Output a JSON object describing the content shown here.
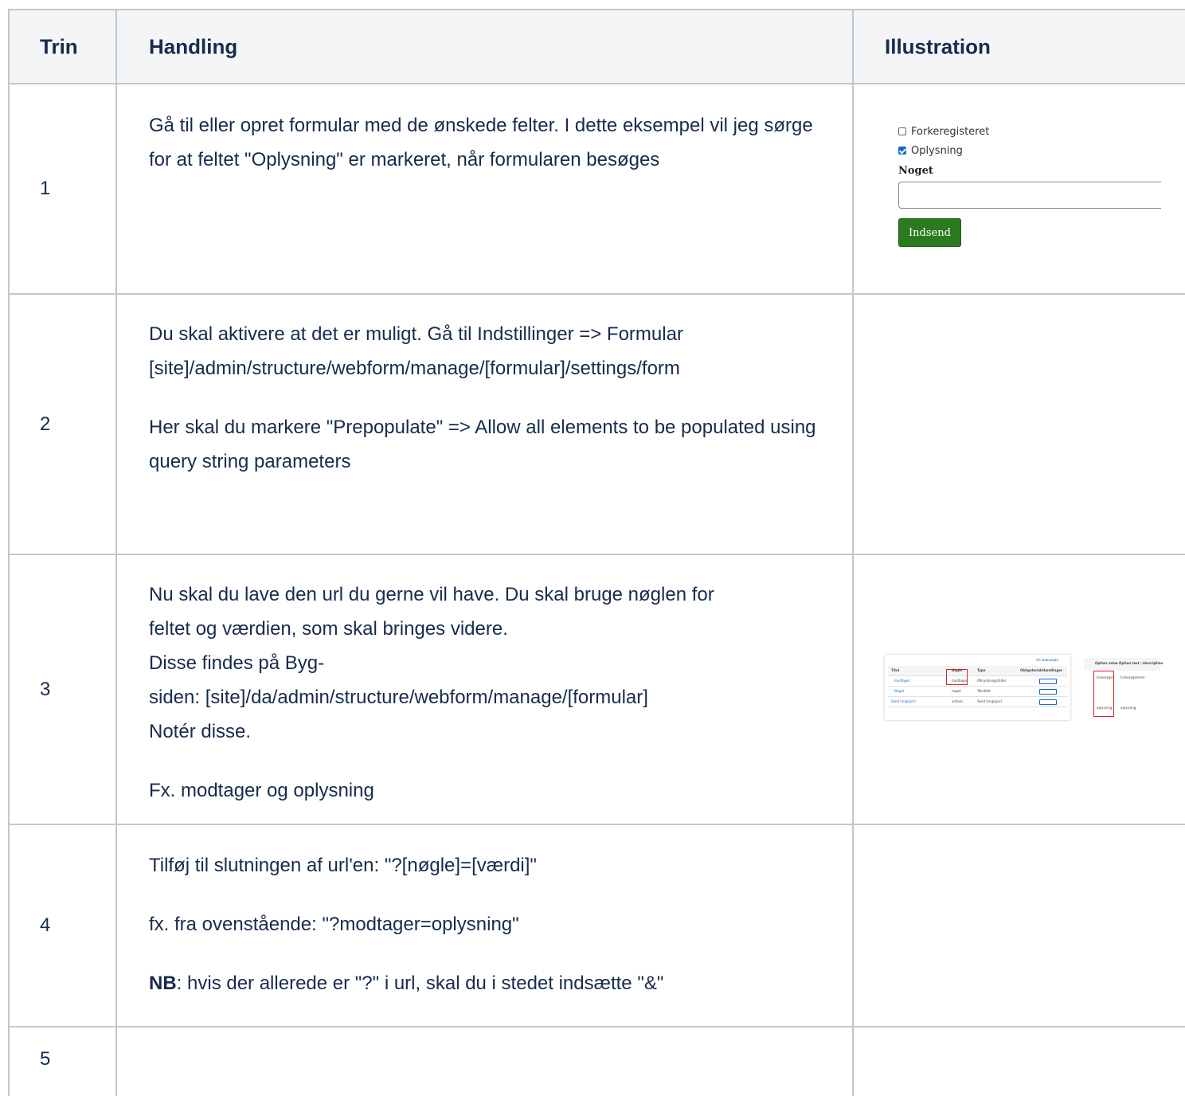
{
  "headers": {
    "step": "Trin",
    "action": "Handling",
    "illustration": "Illustration"
  },
  "rows": [
    {
      "step": "1",
      "paragraphs": [
        "Gå til eller opret formular med de ønskede felter. I dette eksempel vil jeg sørge for at feltet \"Oplysning\" er markeret, når formularen besøges"
      ]
    },
    {
      "step": "2",
      "paragraphs": [
        "Du skal aktivere at det er muligt. Gå til Indstillinger => Formular [site]/admin/structure/webform/manage/[formular]/settings/form",
        "Her skal du markere \"Prepopulate\" => Allow all elements to be populated using query string parameters"
      ]
    },
    {
      "step": "3",
      "lines": [
        "Nu skal du lave den url du gerne vil have. Du skal bruge nøglen for",
        "feltet og værdien, som skal bringes videre.",
        "Disse findes på Byg-",
        "siden: [site]/da/admin/structure/webform/manage/[formular]",
        "Notér disse."
      ],
      "example": "Fx. modtager og oplysning"
    },
    {
      "step": "4",
      "p1": "Tilføj til slutningen af url'en: \"?[nøgle]=[værdi]\"",
      "p2": "fx. fra ovenstående: \"?modtager=oplysning\"",
      "nb_bold": "NB",
      "nb_rest": ": hvis der allerede er \"?\" i url, skal du i stedet indsætte \"&\""
    },
    {
      "step": "5"
    }
  ],
  "illustration1": {
    "checkbox1": {
      "label": "Forkeregisteret",
      "checked": false
    },
    "checkbox2": {
      "label": "Oplysning",
      "checked": true
    },
    "field_label": "Noget",
    "field_value": "",
    "submit_label": "Indsend",
    "submit_color": "#2b7a1f"
  },
  "illustration3": {
    "table_headers": [
      "Titel",
      "Nøgle",
      "Type",
      "Obligatorisk",
      "Handlinger"
    ],
    "table_rows": [
      [
        "modtager",
        "modtager",
        "Afkrydsningsfelter",
        "",
        "Rediger"
      ],
      [
        "Noget",
        "noget",
        "Tekstfelt",
        "",
        "Rediger"
      ],
      [
        "Send knap(per)",
        "actions",
        "Send knap(per)",
        "",
        "Ret"
      ]
    ],
    "link": "Vis webvægte",
    "options_headers": [
      "Option value",
      "Option text / description"
    ],
    "options": [
      [
        "Forkeregist",
        "Forkeregisteret"
      ],
      [
        "oplysning",
        "oplysning"
      ]
    ],
    "highlight_color": "#d9252b"
  }
}
